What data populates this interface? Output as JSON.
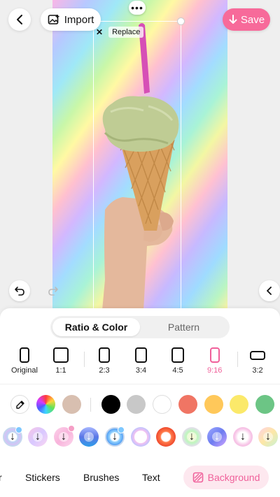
{
  "header": {
    "import_label": "Import",
    "save_label": "Save",
    "replace_label": "Replace",
    "more_label": "•••"
  },
  "colors": {
    "accent": "#f0609a",
    "save_bg": "#f76a9a",
    "tab_active_bg": "#fde8ef"
  },
  "panel": {
    "segments": [
      {
        "label": "Ratio & Color",
        "active": true
      },
      {
        "label": "Pattern",
        "active": false
      }
    ],
    "ratios": [
      {
        "label": "Original"
      },
      {
        "label": "1:1"
      },
      {
        "label": "2:3"
      },
      {
        "label": "3:4"
      },
      {
        "label": "4:5"
      },
      {
        "label": "9:16",
        "active": true
      },
      {
        "label": "3:2"
      }
    ],
    "swatches": [
      "eyedropper-icon",
      "color-wheel-icon",
      "#d8bfb0",
      "#000000",
      "#c8c8c8",
      "#ffffff",
      "#f07564",
      "#ffc85a",
      "#fbe96a",
      "#6cc585"
    ],
    "tabs": [
      {
        "label": "r"
      },
      {
        "label": "Stickers"
      },
      {
        "label": "Brushes"
      },
      {
        "label": "Text"
      },
      {
        "label": "Background",
        "active": true
      }
    ]
  }
}
